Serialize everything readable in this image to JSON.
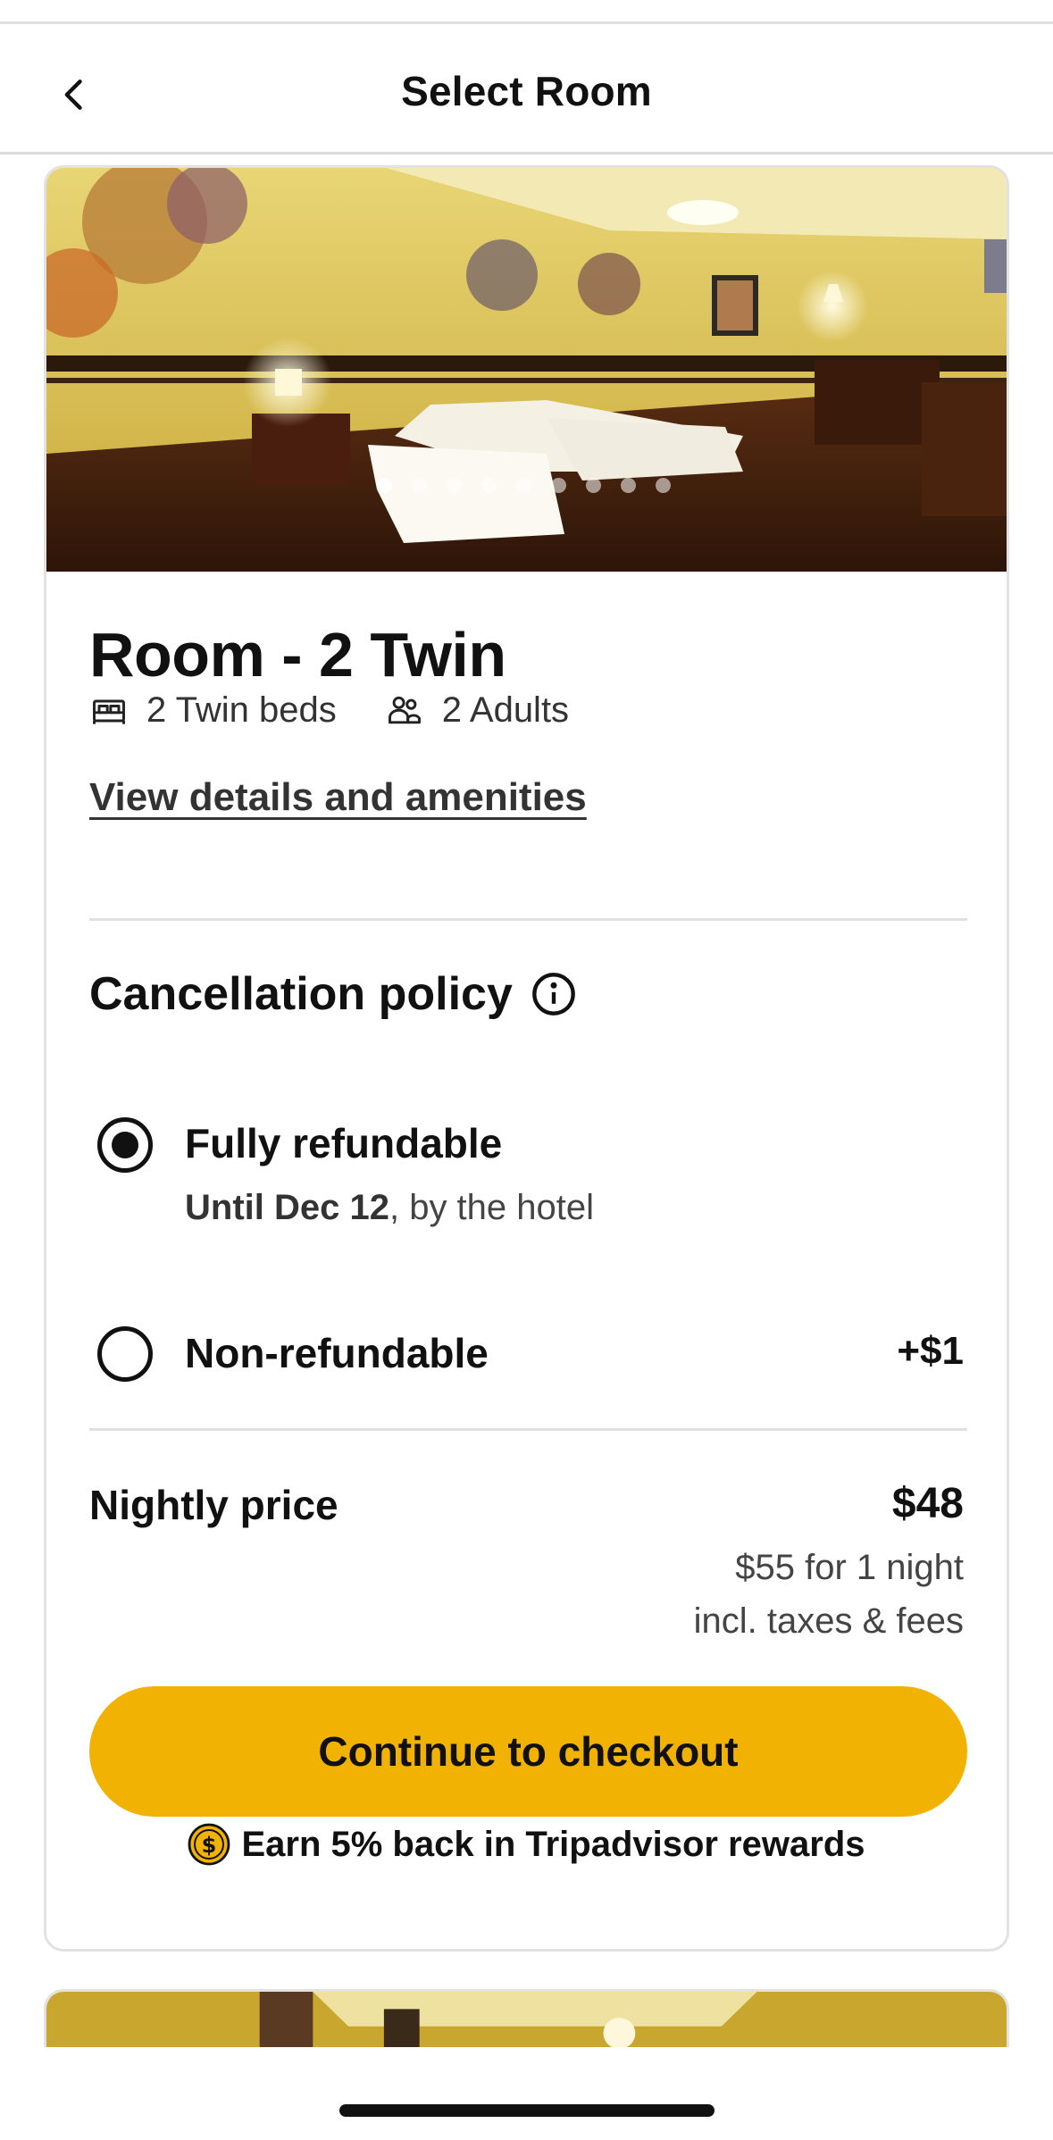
{
  "header": {
    "title": "Select Room",
    "back_icon": "chevron-left-icon"
  },
  "room": {
    "photo_alt": "Hotel room with two twin beds",
    "carousel": {
      "total": 9,
      "active_index": 0
    },
    "title": "Room - 2 Twin",
    "beds": "2 Twin beds",
    "bed_icon": "bed-icon",
    "guests": "2 Adults",
    "guests_icon": "people-icon",
    "details_link": "View details and amenities"
  },
  "cancellation": {
    "title": "Cancellation policy",
    "info_icon": "info-icon",
    "options": [
      {
        "label": "Fully refundable",
        "sub_bold": "Until Dec 12",
        "sub_rest": ", by the hotel",
        "selected": true,
        "price": ""
      },
      {
        "label": "Non-refundable",
        "selected": false,
        "price": "+$1"
      }
    ]
  },
  "pricing": {
    "nightly_label": "Nightly price",
    "nightly_price": "$48",
    "total": "$55 for 1 night",
    "tax_note": "incl. taxes & fees"
  },
  "checkout": {
    "button_label": "Continue to checkout"
  },
  "rewards": {
    "text": "Earn 5% back in Tripadvisor rewards",
    "icon": "dollar-coin-icon"
  },
  "colors": {
    "accent": "#f2b203",
    "text": "#111111",
    "muted": "#444444",
    "divider": "#e0e0e0"
  }
}
